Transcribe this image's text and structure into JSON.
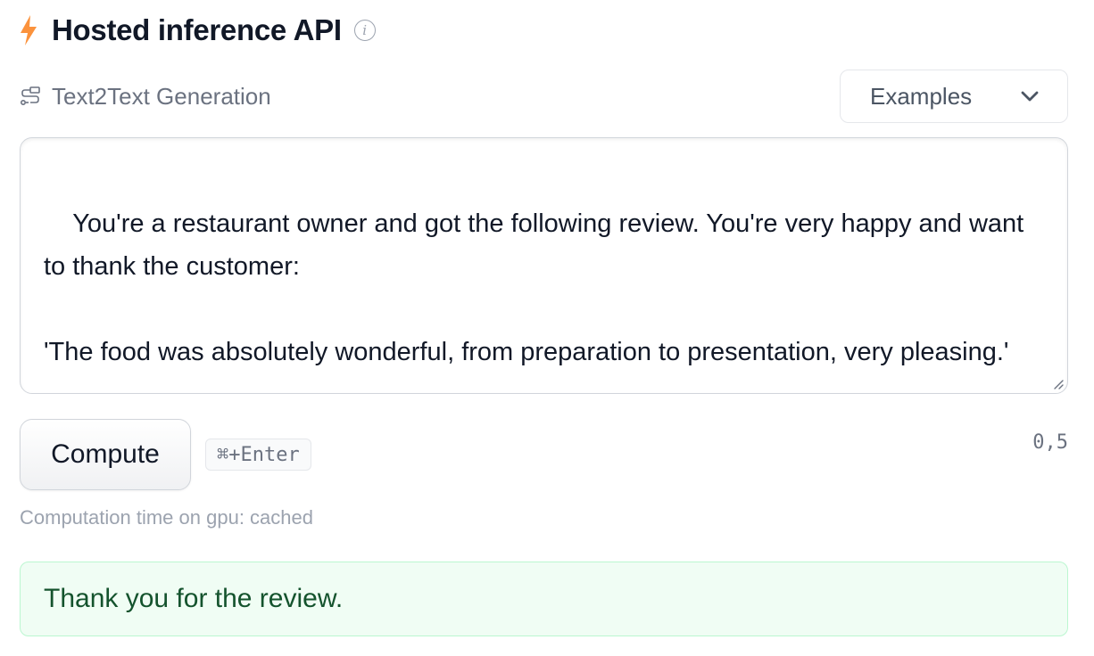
{
  "header": {
    "title": "Hosted inference API",
    "info_glyph": "i",
    "accent_color": "#fb923c"
  },
  "task": {
    "label": "Text2Text Generation",
    "icon": "text2text-icon"
  },
  "examples": {
    "label": "Examples"
  },
  "input": {
    "value": "You're a restaurant owner and got the following review. You're very happy and want to thank the customer:\n\n'The food was absolutely wonderful, from preparation to presentation, very pleasing.'"
  },
  "compute": {
    "button_label": "Compute",
    "shortcut": "⌘+Enter",
    "version": "0,5"
  },
  "computation_time": "Computation time on gpu: cached",
  "output": {
    "text": "Thank you for the review.",
    "background_color": "#f0fdf4",
    "border_color": "#bbf7d0"
  }
}
